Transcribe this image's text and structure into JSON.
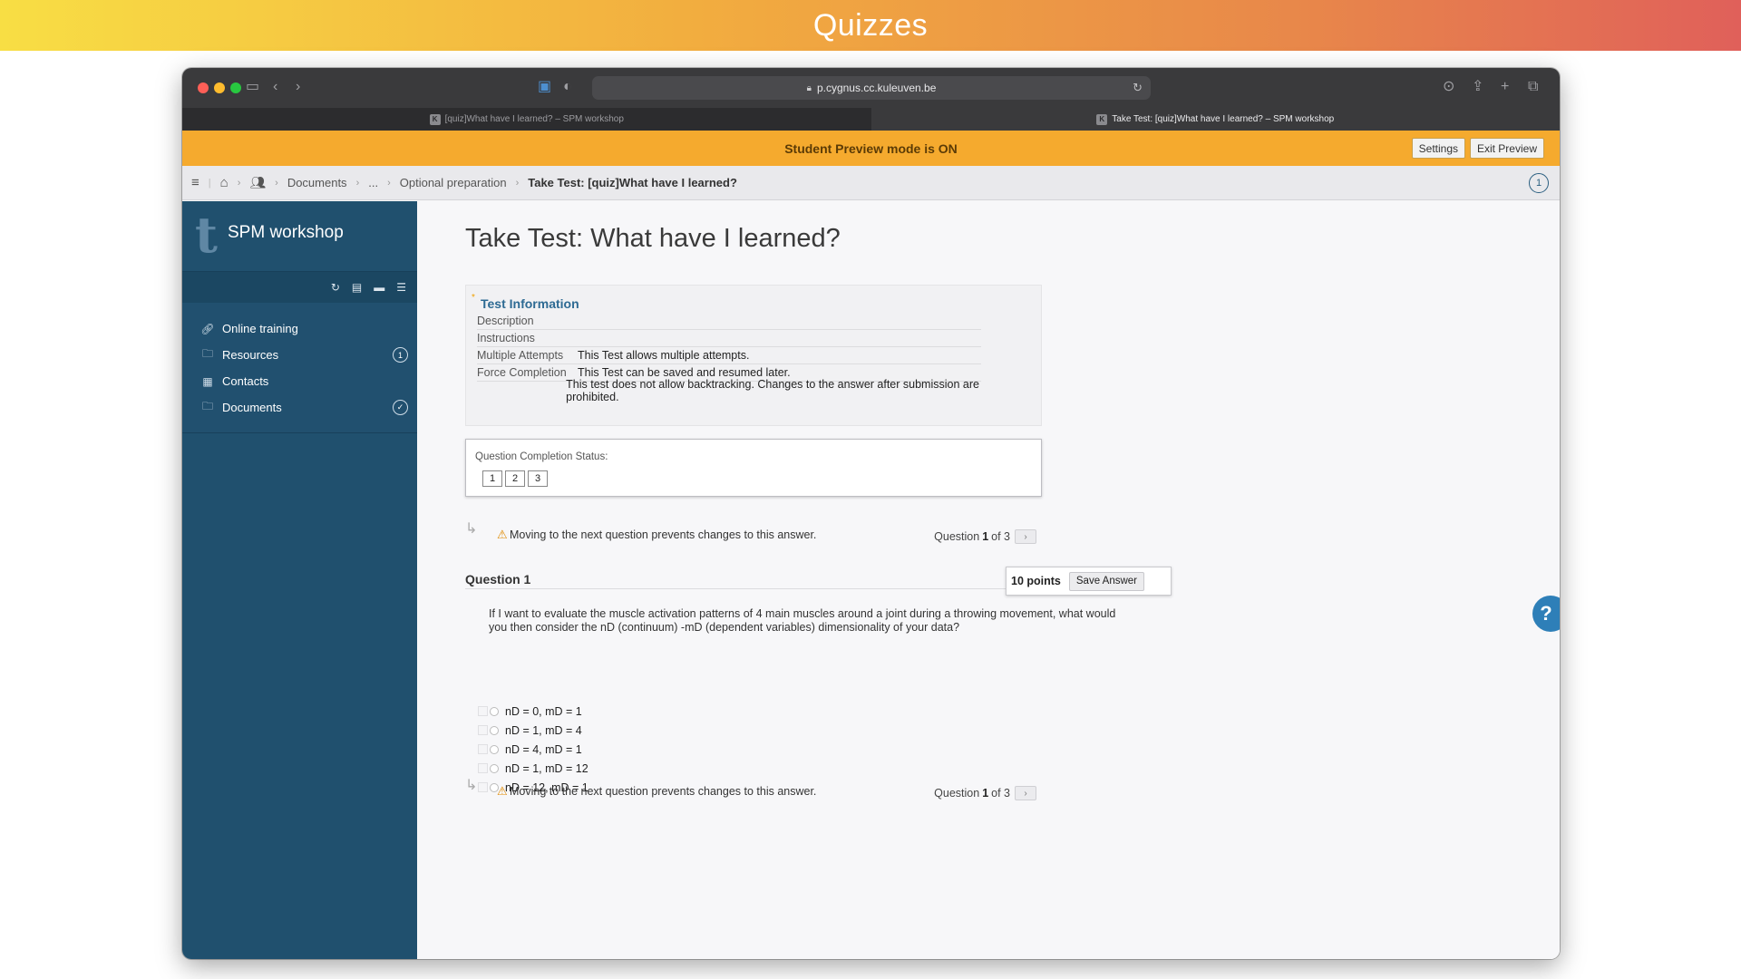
{
  "slide": {
    "title": "Quizzes"
  },
  "browser": {
    "url": "p.cygnus.cc.kuleuven.be",
    "tabs": [
      {
        "label": "[quiz]What have I learned? – SPM workshop",
        "active": false
      },
      {
        "label": "Take Test: [quiz]What have I learned? – SPM workshop",
        "active": true
      }
    ]
  },
  "preview": {
    "banner": "Student Preview mode is ON",
    "settings_label": "Settings",
    "exit_label": "Exit Preview"
  },
  "breadcrumb": {
    "items": [
      "Documents",
      "...",
      "Optional preparation"
    ],
    "current": "Take Test: [quiz]What have I learned?",
    "notification_count": "1"
  },
  "sidebar": {
    "logo_letter": "t",
    "course_title": "SPM workshop",
    "items": [
      {
        "label": "Online training",
        "icon": "link-icon"
      },
      {
        "label": "Resources",
        "icon": "folder-icon",
        "badge": "1"
      },
      {
        "label": "Contacts",
        "icon": "contact-card-icon"
      },
      {
        "label": "Documents",
        "icon": "folder-icon",
        "badge": "✓"
      }
    ]
  },
  "main": {
    "page_title": "Take Test: What have I learned?",
    "info": {
      "heading": "Test Information",
      "rows": [
        {
          "label": "Description",
          "value": ""
        },
        {
          "label": "Instructions",
          "value": ""
        },
        {
          "label": "Multiple Attempts",
          "value": "This Test allows multiple attempts."
        },
        {
          "label": "Force Completion",
          "value": "This Test can be saved and resumed later."
        },
        {
          "label": "",
          "value": "This test does not allow backtracking. Changes to the answer after submission are prohibited."
        }
      ]
    },
    "completion": {
      "label": "Question Completion Status:",
      "numbers": [
        "1",
        "2",
        "3"
      ]
    },
    "warning": "Moving to the next question prevents changes to this answer.",
    "counter": {
      "prefix": "Question",
      "current": "1",
      "of": "of 3"
    },
    "question": {
      "title": "Question 1",
      "points": "10 points",
      "save_label": "Save Answer",
      "text": "If I want to evaluate the muscle activation patterns of 4 main muscles around a joint during a throwing movement, what would you then consider the nD (continuum) -mD (dependent variables) dimensionality of your data?",
      "options": [
        "nD = 0, mD = 1",
        "nD = 1, mD = 4",
        "nD = 4, mD = 1",
        "nD = 1, mD = 12",
        "nD = 12, mD = 1"
      ]
    },
    "help_label": "?"
  },
  "colors": {
    "preview_banner": "#f5aa2e",
    "sidebar": "#20506e",
    "accent_link": "#2d6a93",
    "help_button": "#2e7fb8"
  }
}
